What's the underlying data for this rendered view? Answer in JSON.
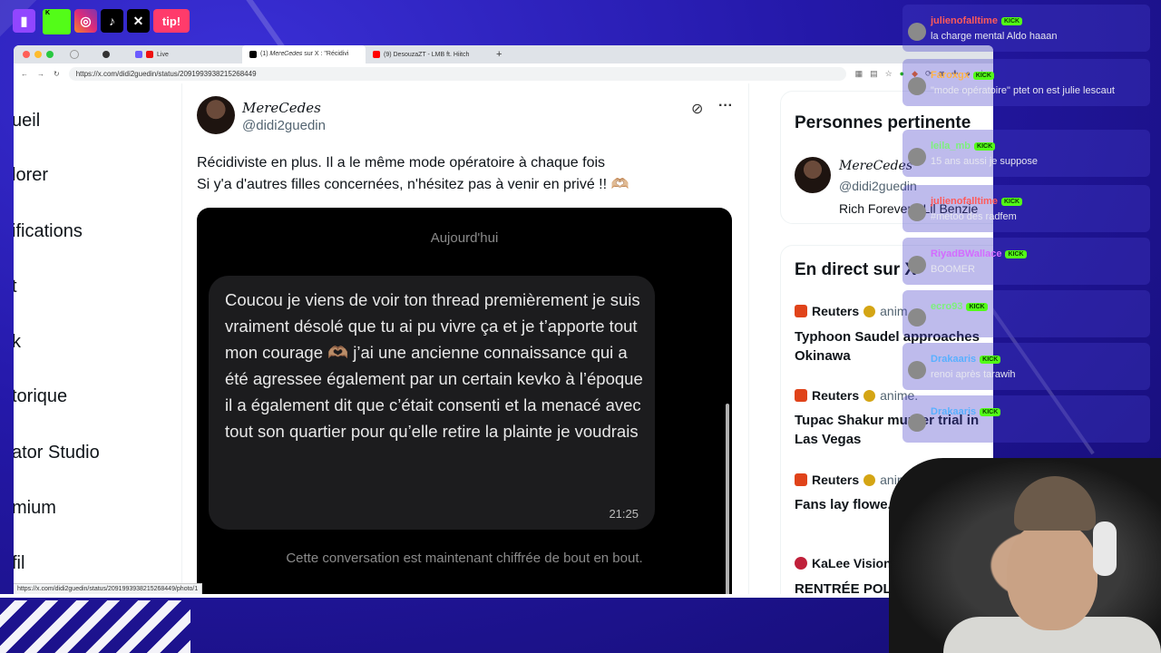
{
  "social": [
    "twitch",
    "kick",
    "instagram",
    "tiktok",
    "x",
    "tip!"
  ],
  "social_tip_label": "tip!",
  "browser": {
    "tabs": [
      {
        "label": "Live",
        "active": false
      },
      {
        "label": "(1) 𝑀𝑒𝑟𝑒𝐶𝑒𝑑𝑒𝑠 sur X : \"Récidivi",
        "active": true
      },
      {
        "label": "(9) DesouzaZT - LMB ft. Hiitch",
        "active": false
      }
    ],
    "new_tab": "+",
    "url": "https://x.com/didi2guedin/status/2091993938215268449",
    "status_url": "https://x.com/didi2guedin/status/2091993938215268449/photo/1"
  },
  "leftnav": [
    "ueil",
    "lorer",
    "ifications",
    "t",
    "k",
    "torique",
    "ator Studio",
    "mium",
    "fil"
  ],
  "tweet": {
    "display_name": "𝑀𝑒𝑟𝑒𝐶𝑒𝑑𝑒𝑠",
    "handle": "@didi2guedin",
    "more": "···",
    "text_line1": "Récidiviste en plus. Il a le même mode opératoire à chaque fois",
    "text_line2": "Si y'a d'autres filles concernées, n'hésitez pas à venir en privé !! 🫶🏼",
    "media": {
      "day_label": "Aujourd'hui",
      "message": "Coucou je viens de voir ton thread premièrement je suis vraiment désolé que tu ai pu vivre ça et je t’apporte tout mon courage 🫶🏽 j’ai une ancienne connaissance qui a été agressee également par un certain kevko à l’époque il a également dit que c’était consenti et la menacé avec tout son quartier pour qu’elle retire la plainte je voudrais",
      "time": "21:25",
      "encryption_notice": "Cette conversation est maintenant chiffrée de bout en bout."
    }
  },
  "right": {
    "relevant_title": "Personnes pertinente",
    "relevant_name": "𝑀𝑒𝑟𝑒𝐶𝑒𝑑𝑒𝑠",
    "relevant_handle": "@didi2guedin",
    "relevant_bio": "Rich Forever - Lil Benzie",
    "live_title": "En direct sur X",
    "items": [
      {
        "source": "Reuters",
        "meta": "anim",
        "headline": "Typhoon Saudel approaches Okinawa"
      },
      {
        "source": "Reuters",
        "meta": "anime.",
        "headline": "Tupac Shakur murder trial in Las Vegas"
      },
      {
        "source": "Reuters",
        "meta": "anim",
        "headline": "Fans lay flowe... Parton's Holly"
      },
      {
        "source": "KaLee Vision",
        "meta": "",
        "headline": "RENTRÉE POL"
      }
    ]
  },
  "chat": [
    {
      "user": "julienofalltime",
      "color": "#ff5a5a",
      "text": "la charge mental Aldo haaan"
    },
    {
      "user": "Faroxgx",
      "color": "#ffb347",
      "text": "\"mode opératoire\" ptet on est julie lescaut"
    },
    {
      "user": "leila_mb",
      "color": "#7df07d",
      "text": "15 ans aussi je suppose"
    },
    {
      "user": "julienofalltime",
      "color": "#ff5a5a",
      "text": "#metoo des radfem"
    },
    {
      "user": "RiyadBWallace",
      "color": "#d36bff",
      "text": "BOOMER"
    },
    {
      "user": "ecro93",
      "color": "#7df07d",
      "text": ""
    },
    {
      "user": "Drakaaris",
      "color": "#5ab0ff",
      "text": "renoi après tarawih"
    },
    {
      "user": "Drakaaris",
      "color": "#5ab0ff",
      "text": ""
    }
  ],
  "kick_badge": "KICK"
}
